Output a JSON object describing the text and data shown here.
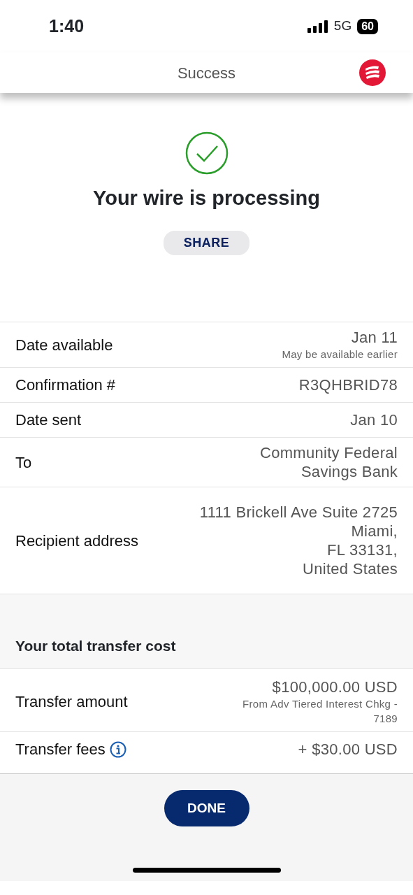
{
  "status_bar": {
    "time": "1:40",
    "network": "5G",
    "battery": "60"
  },
  "header": {
    "title": "Success"
  },
  "result": {
    "title": "Your wire is processing",
    "share_button": "SHARE"
  },
  "details": [
    {
      "label": "Date available",
      "value": [
        "Jan 11"
      ],
      "note": [
        "May be available earlier"
      ],
      "info": false
    },
    {
      "label": "Confirmation #",
      "value": [
        "R3QHBRID78"
      ],
      "info": false
    },
    {
      "label": "Date sent",
      "value": [
        "Jan 10"
      ],
      "info": false
    },
    {
      "label": "To",
      "value": [
        "Community Federal",
        "Savings Bank"
      ],
      "info": false
    },
    {
      "label": "Recipient address",
      "value": [
        "1111 Brickell Ave Suite 2725",
        "Miami,",
        "FL 33131,",
        "United States"
      ],
      "info": false
    }
  ],
  "cost": {
    "heading": "Your total transfer cost",
    "rows": [
      {
        "label": "Transfer amount",
        "value": [
          "$100,000.00 USD"
        ],
        "note": [
          "From Adv Tiered Interest Chkg -",
          "7189"
        ],
        "info": false
      },
      {
        "label": "Transfer fees",
        "value": [
          "+ $30.00 USD"
        ],
        "info": true
      }
    ]
  },
  "done_button": "DONE"
}
